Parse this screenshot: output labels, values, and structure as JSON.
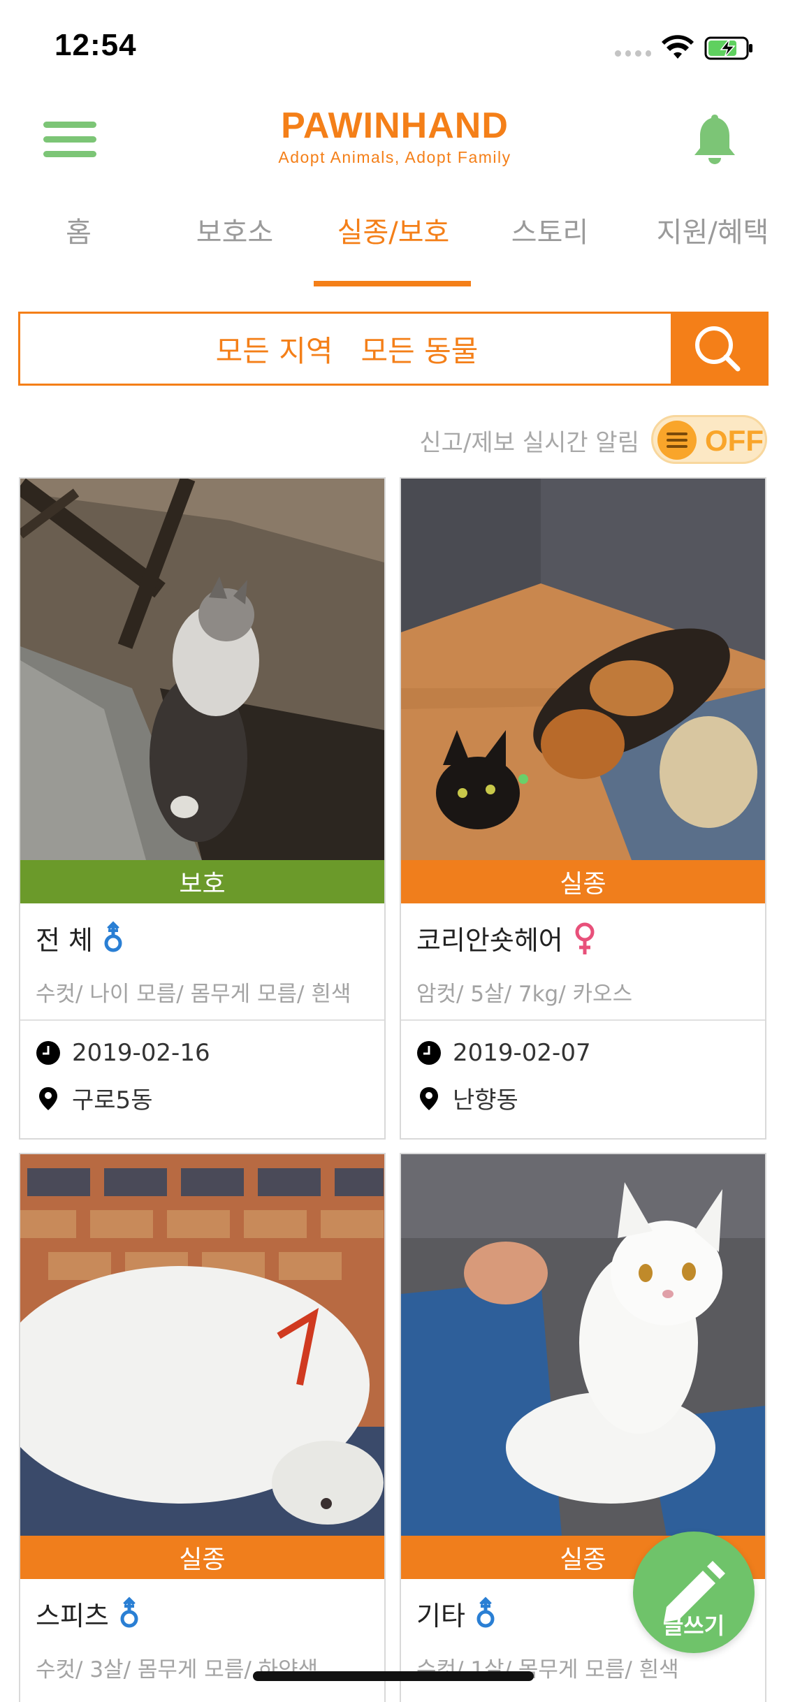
{
  "status_bar": {
    "time": "12:54"
  },
  "header": {
    "logo_title": "PAWINHAND",
    "logo_subtitle": "Adopt Animals, Adopt Family"
  },
  "tabs": [
    {
      "label": "홈",
      "active": false
    },
    {
      "label": "보호소",
      "active": false
    },
    {
      "label": "실종/보호",
      "active": true
    },
    {
      "label": "스토리",
      "active": false
    },
    {
      "label": "지원/혜택",
      "active": false
    }
  ],
  "search": {
    "region": "모든 지역",
    "animal": "모든 동물"
  },
  "alert": {
    "label": "신고/제보 실시간 알림",
    "toggle_state": "OFF"
  },
  "cards": [
    {
      "status": "보호",
      "title": "전 체",
      "gender": "male",
      "desc": "수컷/ 나이 모름/ 몸무게 모름/ 흰색",
      "date": "2019-02-16",
      "location": "구로5동"
    },
    {
      "status": "실종",
      "title": "코리안숏헤어",
      "gender": "female",
      "desc": "암컷/ 5살/ 7kg/ 카오스",
      "date": "2019-02-07",
      "location": "난향동"
    },
    {
      "status": "실종",
      "title": "스피츠",
      "gender": "male",
      "desc": "수컷/ 3살/ 몸무게 모름/ 하얀색",
      "date": "",
      "location": ""
    },
    {
      "status": "실종",
      "title": "기타",
      "gender": "male",
      "desc": "수컷/ 1살/ 몸무게 모름/ 흰색",
      "date": "",
      "location": ""
    }
  ],
  "fab": {
    "label": "글쓰기"
  },
  "colors": {
    "accent": "#f47f18",
    "green": "#7cc576",
    "protect": "#6b9a2a",
    "lost": "#f07e1c",
    "male": "#2a7fd4",
    "female": "#e8507a"
  }
}
